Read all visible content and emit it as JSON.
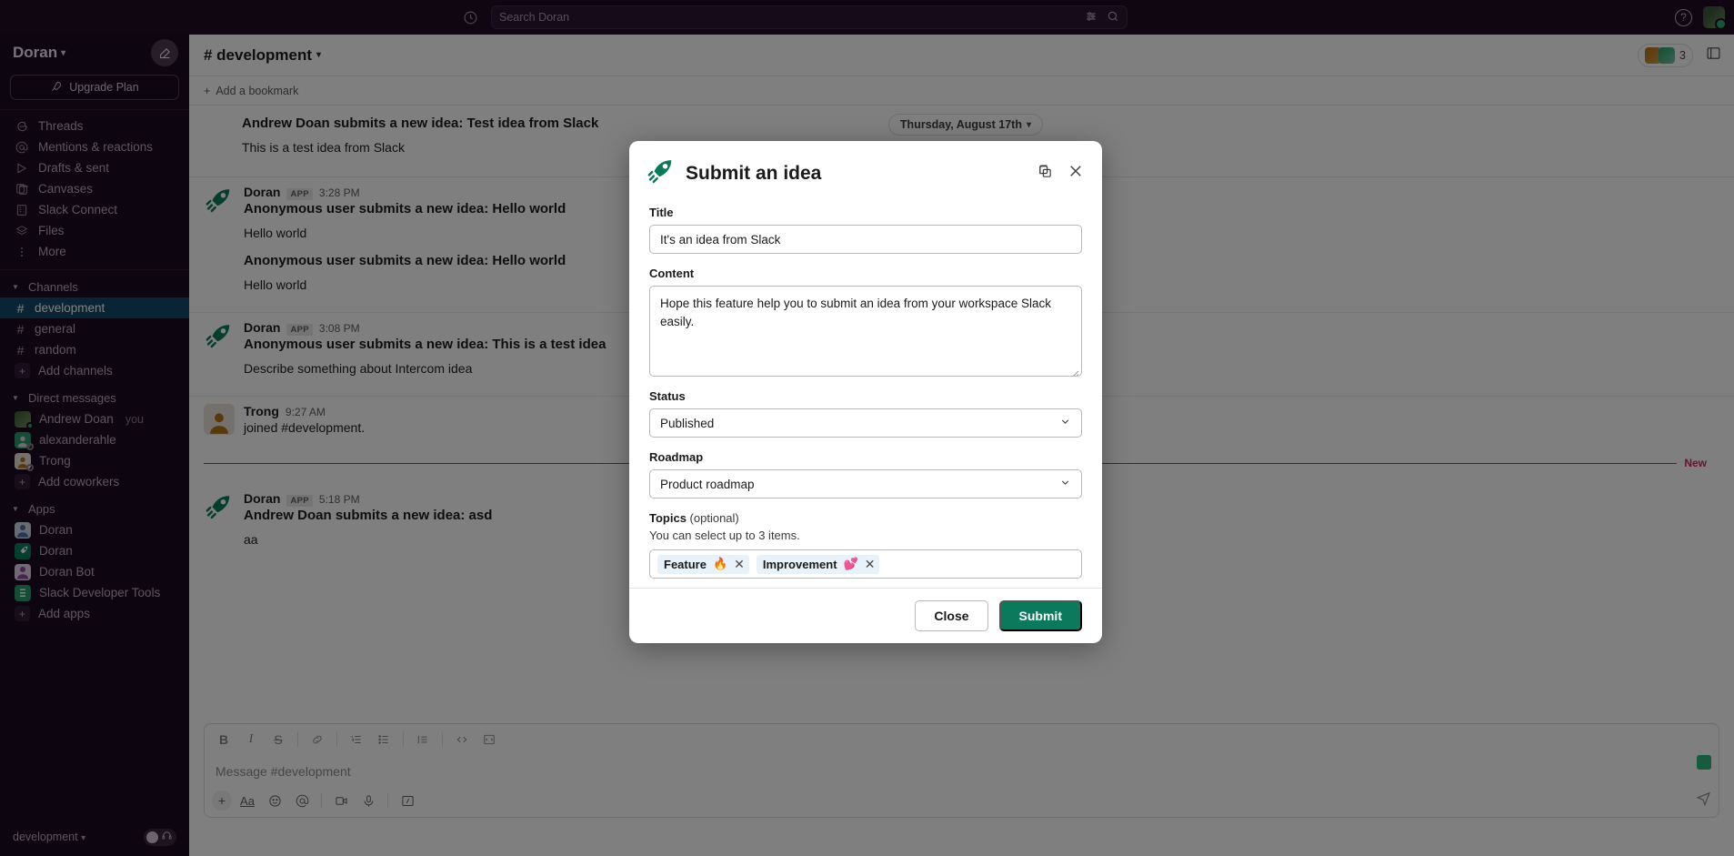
{
  "topbar": {
    "history_icon": "clock-icon",
    "search_placeholder": "Search Doran",
    "filter_icon": "filter-icon",
    "search_icon": "search-icon",
    "help_label": "?"
  },
  "sidebar": {
    "workspace_name": "Doran",
    "compose_icon": "compose-icon",
    "upgrade_label": "Upgrade Plan",
    "nav": [
      {
        "label": "Threads",
        "icon": "threads-icon"
      },
      {
        "label": "Mentions & reactions",
        "icon": "at-icon"
      },
      {
        "label": "Drafts & sent",
        "icon": "send-icon"
      },
      {
        "label": "Canvases",
        "icon": "canvas-icon"
      },
      {
        "label": "Slack Connect",
        "icon": "building-icon"
      },
      {
        "label": "Files",
        "icon": "files-icon"
      },
      {
        "label": "More",
        "icon": "more-icon"
      }
    ],
    "channels_header": "Channels",
    "channels": [
      {
        "label": "development",
        "active": true
      },
      {
        "label": "general",
        "active": false
      },
      {
        "label": "random",
        "active": false
      }
    ],
    "add_channels_label": "Add channels",
    "dm_header": "Direct messages",
    "dms": [
      {
        "label": "Andrew Doan",
        "suffix": "you",
        "presence": "on",
        "color": "#4a5f3a"
      },
      {
        "label": "alexanderahle",
        "suffix": "",
        "presence": "off",
        "color": "#2a9d6e"
      },
      {
        "label": "Trong",
        "suffix": "",
        "presence": "off",
        "color": "#b07219"
      }
    ],
    "add_coworkers_label": "Add coworkers",
    "apps_header": "Apps",
    "apps": [
      {
        "label": "Doran",
        "color": "#4a6fa5"
      },
      {
        "label": "Doran",
        "color": "#0b7a5c"
      },
      {
        "label": "Doran Bot",
        "color": "#8e4a9e"
      },
      {
        "label": "Slack Developer Tools",
        "color": "#2a9d6e"
      }
    ],
    "add_apps_label": "Add apps",
    "footer_channel": "development"
  },
  "channel": {
    "title": "# development",
    "member_count": "3",
    "bookmark_label": "Add a bookmark",
    "date_pill": "Thursday, August 17th",
    "new_label": "New"
  },
  "messages": [
    {
      "heading": "Andrew Doan submits a new idea: Test idea from Slack",
      "text": "This is a test idea from Slack",
      "author": "",
      "badge": "",
      "time": "",
      "show_avatar": false
    },
    {
      "author": "Doran",
      "badge": "APP",
      "time": "3:28 PM",
      "heading": "Anonymous user submits a new idea: Hello world",
      "text": "Hello world",
      "sub_heading": "Anonymous user submits a new idea: Hello world",
      "sub_text": "Hello world",
      "show_avatar": true
    },
    {
      "author": "Doran",
      "badge": "APP",
      "time": "3:08 PM",
      "heading": "Anonymous user submits a new idea: This is a test idea",
      "text": "Describe something about Intercom idea",
      "show_avatar": true
    },
    {
      "author": "Trong",
      "badge": "",
      "time": "9:27 AM",
      "heading": "",
      "text": "joined #development.",
      "show_avatar": true
    },
    {
      "author": "Doran",
      "badge": "APP",
      "time": "5:18 PM",
      "heading": "Andrew Doan submits a new idea: asd",
      "text": "aa",
      "show_avatar": true
    }
  ],
  "composer": {
    "placeholder": "Message #development",
    "toolbar": [
      "bold-icon",
      "italic-icon",
      "strikethrough-icon",
      "link-icon",
      "ordered-list-icon",
      "bullet-list-icon",
      "blockquote-icon",
      "code-icon",
      "code-block-icon"
    ],
    "bottom_icons": [
      "plus-icon",
      "format-icon",
      "emoji-icon",
      "mention-icon",
      "video-icon",
      "mic-icon",
      "slash-icon"
    ],
    "send_icon": "send-icon"
  },
  "modal": {
    "app_icon": "doran-rocket-icon",
    "title": "Submit an idea",
    "copy_icon": "copy-icon",
    "close_icon": "close-icon",
    "fields": {
      "title_label": "Title",
      "title_value": "It's an idea from Slack",
      "content_label": "Content",
      "content_value": "Hope this feature help you to submit an idea from your workspace Slack easily.",
      "status_label": "Status",
      "status_value": "Published",
      "roadmap_label": "Roadmap",
      "roadmap_value": "Product roadmap",
      "topics_label": "Topics",
      "topics_optional": " (optional)",
      "topics_hint": "You can select up to 3 items.",
      "topics": [
        {
          "label": "Feature",
          "emoji": "🔥"
        },
        {
          "label": "Improvement",
          "emoji": "💕"
        }
      ]
    },
    "close_label": "Close",
    "submit_label": "Submit"
  },
  "colors": {
    "brand_green": "#0b7a5c",
    "sidebar_bg": "#1a0a1e",
    "active_channel": "#12486b",
    "new_red": "#e01e5a",
    "chip_bg": "#e8f2fa"
  }
}
